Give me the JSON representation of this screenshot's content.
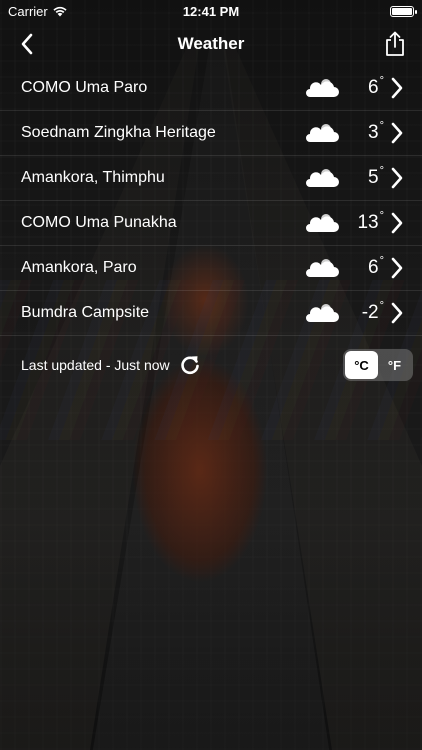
{
  "status_bar": {
    "carrier": "Carrier",
    "time": "12:41 PM"
  },
  "nav": {
    "title": "Weather",
    "back_icon": "chevron-left-icon",
    "share_icon": "share-icon"
  },
  "locations": [
    {
      "name": "COMO Uma Paro",
      "temp": "6",
      "icon": "partly-cloudy-icon"
    },
    {
      "name": "Soednam Zingkha Heritage",
      "temp": "3",
      "icon": "partly-cloudy-icon"
    },
    {
      "name": "Amankora, Thimphu",
      "temp": "5",
      "icon": "partly-cloudy-icon"
    },
    {
      "name": "COMO Uma Punakha",
      "temp": "13",
      "icon": "partly-cloudy-icon"
    },
    {
      "name": "Amankora, Paro",
      "temp": "6",
      "icon": "partly-cloudy-icon"
    },
    {
      "name": "Bumdra Campsite",
      "temp": "-2",
      "icon": "partly-cloudy-icon"
    }
  ],
  "degree_symbol": "°",
  "footer": {
    "last_updated": "Last updated - Just now",
    "unit_celsius": "°C",
    "unit_fahrenheit": "°F",
    "selected_unit": "°C"
  }
}
